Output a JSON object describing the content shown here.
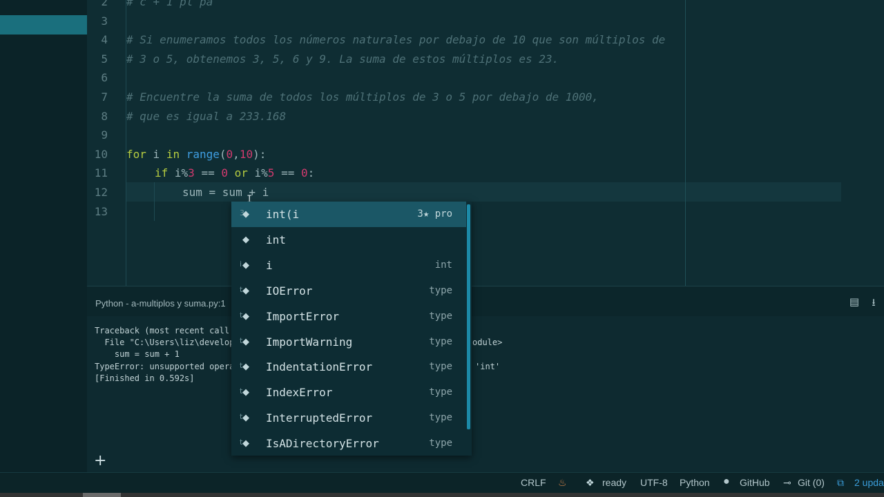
{
  "editor": {
    "lines": [
      {
        "num": "2",
        "kind": "comment",
        "text": "# c + 1 pl pa"
      },
      {
        "num": "3",
        "kind": "blank",
        "text": ""
      },
      {
        "num": "4",
        "kind": "comment",
        "text": "# Si enumeramos todos los números naturales por debajo de 10 que son múltiplos de"
      },
      {
        "num": "5",
        "kind": "comment",
        "text": "# 3 o 5, obtenemos 3, 5, 6 y 9. La suma de estos múltiplos es 23."
      },
      {
        "num": "6",
        "kind": "blank",
        "text": ""
      },
      {
        "num": "7",
        "kind": "comment",
        "text": "# Encuentre la suma de todos los múltiplos de 3 o 5 por debajo de 1000,"
      },
      {
        "num": "8",
        "kind": "comment",
        "text": "# que es igual a 233.168"
      },
      {
        "num": "9",
        "kind": "blank",
        "text": ""
      },
      {
        "num": "10",
        "kind": "code",
        "text": ""
      },
      {
        "num": "11",
        "kind": "code",
        "text": ""
      },
      {
        "num": "12",
        "kind": "code",
        "text": ""
      },
      {
        "num": "13",
        "kind": "blank",
        "text": ""
      }
    ],
    "code10": {
      "kw1": "for",
      "v1": " i ",
      "kw2": "in",
      "sp": " ",
      "fn": "range",
      "p1": "(",
      "n1": "0",
      "c": ",",
      "n2": "10",
      "p2": "):"
    },
    "code11": {
      "kw1": "if",
      "a": " i%",
      "n1": "3",
      "b": " == ",
      "n2": "0",
      "sp": " ",
      "kw2": "or",
      "c": " i%",
      "n3": "5",
      "d": " == ",
      "n4": "0",
      "e": ":"
    },
    "code12": {
      "text": "sum = sum + i"
    }
  },
  "panel": {
    "title": "Python - a-multiplos y suma.py:1",
    "console": [
      "Traceback (most recent call l",
      "  File \"C:\\Users\\liz\\develop",
      "    sum = sum + 1",
      "TypeError: unsupported opera",
      "[Finished in 0.592s]"
    ],
    "console_right": [
      "odule>",
      "'int'"
    ],
    "plus": "+"
  },
  "autocomplete": {
    "items": [
      {
        "prefix": "3",
        "label": "int(i",
        "type": "3★ pro",
        "selected": true
      },
      {
        "prefix": "",
        "label": "int",
        "type": "",
        "selected": false
      },
      {
        "prefix": "i",
        "label": "i",
        "type": "int",
        "selected": false
      },
      {
        "prefix": "t",
        "label": "IOError",
        "type": "type",
        "selected": false
      },
      {
        "prefix": "t",
        "label": "ImportError",
        "type": "type",
        "selected": false
      },
      {
        "prefix": "t",
        "label": "ImportWarning",
        "type": "type",
        "selected": false
      },
      {
        "prefix": "t",
        "label": "IndentationError",
        "type": "type",
        "selected": false
      },
      {
        "prefix": "t",
        "label": "IndexError",
        "type": "type",
        "selected": false
      },
      {
        "prefix": "t",
        "label": "InterruptedError",
        "type": "type",
        "selected": false
      },
      {
        "prefix": "t",
        "label": "IsADirectoryError",
        "type": "type",
        "selected": false
      }
    ]
  },
  "statusbar": {
    "line_ending": "CRLF",
    "kite_status": "ready",
    "encoding": "UTF-8",
    "grammar": "Python",
    "github": "GitHub",
    "git": "Git (0)",
    "updates": "2 upda"
  },
  "colors": {
    "comment": "#4e7177",
    "keyword": "#b6cc40",
    "function": "#3f9ee2",
    "number": "#d13a6e",
    "selection": "#1b5766",
    "accent": "#1a6f7d"
  },
  "icons": {
    "autocomplete_item": "kite-icon",
    "panel_save": "document-icon",
    "panel_download": "download-icon",
    "github": "github-icon",
    "git": "git-commit-icon",
    "updates": "package-icon"
  }
}
